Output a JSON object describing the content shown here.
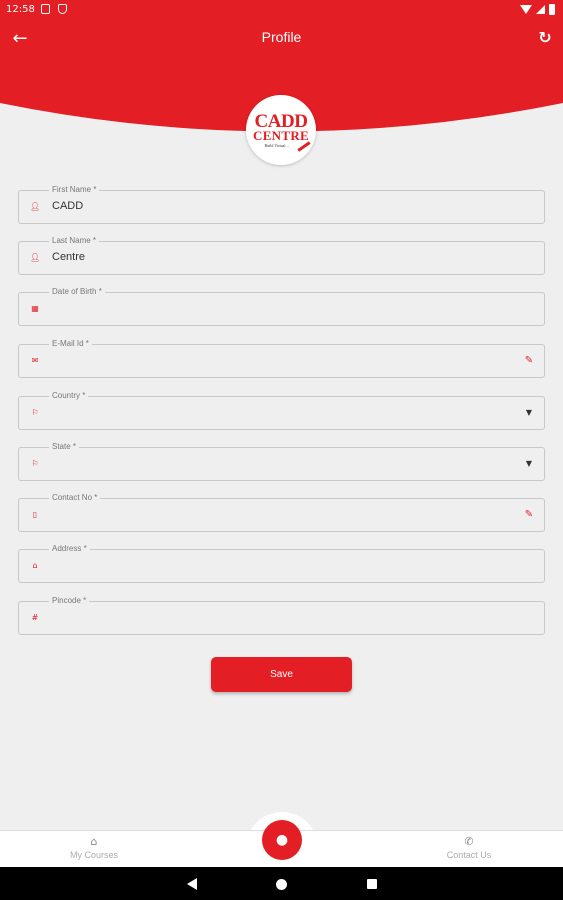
{
  "status_bar": {
    "time": "12:58"
  },
  "header": {
    "title": "Profile",
    "back_icon": "arrow-left-icon",
    "refresh_icon": "refresh-icon"
  },
  "logo": {
    "text_top": "CADD",
    "text_bottom": "CENTRE",
    "tagline": "Build Virtual ..."
  },
  "form": {
    "fields": [
      {
        "label": "First Name *",
        "value": "CADD",
        "icon": "person-icon"
      },
      {
        "label": "Last Name *",
        "value": "Centre",
        "icon": "person-icon"
      },
      {
        "label": "Date of Birth *",
        "value": "",
        "icon": "calendar-icon"
      },
      {
        "label": "E-Mail Id *",
        "value": "",
        "icon": "mail-icon",
        "trailing": "edit-icon"
      },
      {
        "label": "Country *",
        "value": "",
        "icon": "flag-icon",
        "trailing": "dropdown-icon"
      },
      {
        "label": "State *",
        "value": "",
        "icon": "flag-icon",
        "trailing": "dropdown-icon"
      },
      {
        "label": "Contact No *",
        "value": "",
        "icon": "phone-icon",
        "trailing": "edit-icon"
      },
      {
        "label": "Address *",
        "value": "",
        "icon": "home-icon"
      },
      {
        "label": "Pincode *",
        "value": "",
        "icon": "hash-icon"
      }
    ],
    "save_label": "Save"
  },
  "bottom_nav": {
    "items": [
      {
        "label": "My Courses",
        "icon": "home-icon"
      },
      {
        "label": "Contact Us",
        "icon": "phone-icon"
      }
    ],
    "fab_icon": "person-icon"
  },
  "colors": {
    "accent": "#e31e24",
    "background": "#efefef"
  }
}
